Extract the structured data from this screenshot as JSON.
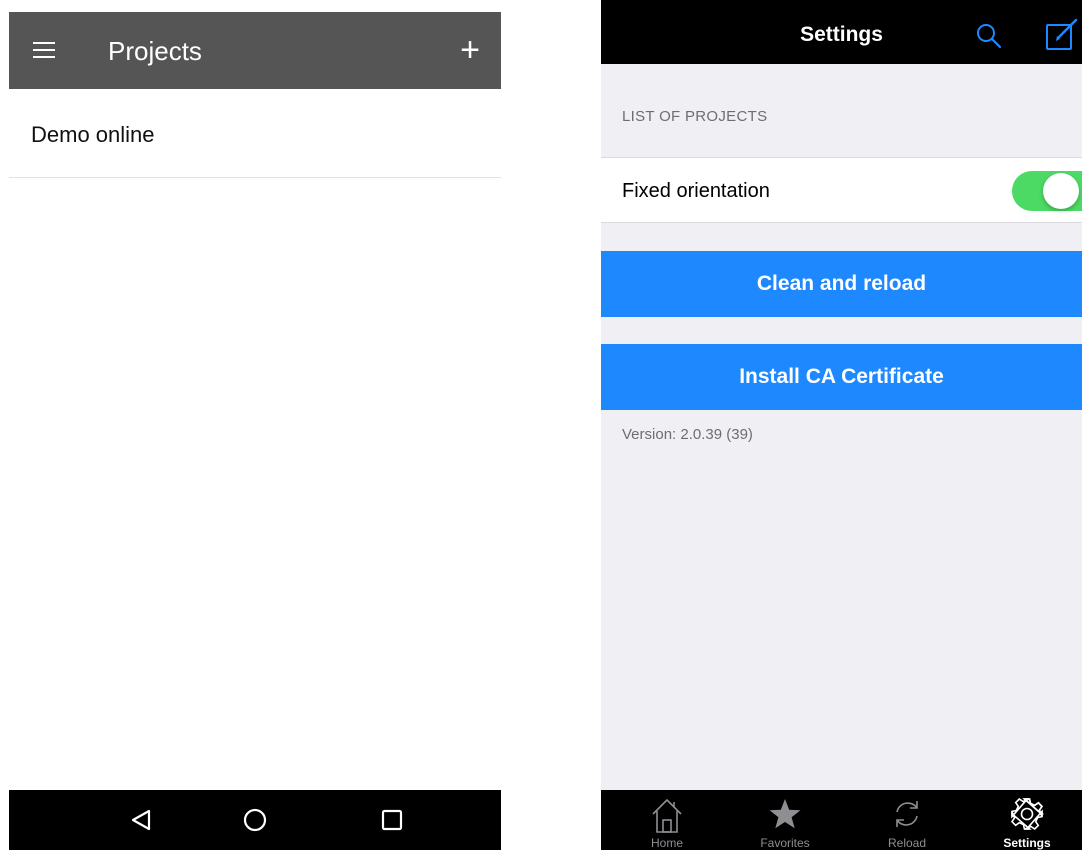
{
  "android": {
    "toolbar": {
      "title": "Projects",
      "menu_icon": "hamburger-menu-icon",
      "add_icon": "plus-icon",
      "add_label": "+"
    },
    "projects": [
      {
        "label": "Demo online"
      }
    ],
    "navbar": {
      "back_icon": "back-triangle-icon",
      "home_icon": "home-circle-icon",
      "recents_icon": "recents-square-icon"
    }
  },
  "ios": {
    "navbar": {
      "title": "Settings",
      "search_icon": "search-icon",
      "compose_icon": "compose-icon"
    },
    "section_header": "LIST OF PROJECTS",
    "fixed_orientation": {
      "label": "Fixed orientation",
      "enabled": true
    },
    "clean_button": "Clean and reload",
    "install_button": "Install CA Certificate",
    "version": "Version: 2.0.39 (39)",
    "tabbar": {
      "tabs": [
        {
          "label": "Home",
          "icon": "home-icon",
          "active": false
        },
        {
          "label": "Favorites",
          "icon": "star-icon",
          "active": false
        },
        {
          "label": "Reload",
          "icon": "reload-icon",
          "active": false
        },
        {
          "label": "Settings",
          "icon": "gear-icon",
          "active": true
        }
      ]
    }
  },
  "colors": {
    "android_toolbar": "#555555",
    "ios_button_blue": "#1e88ff",
    "ios_toggle_green": "#4cd964",
    "ios_accent": "#1e88ff"
  }
}
